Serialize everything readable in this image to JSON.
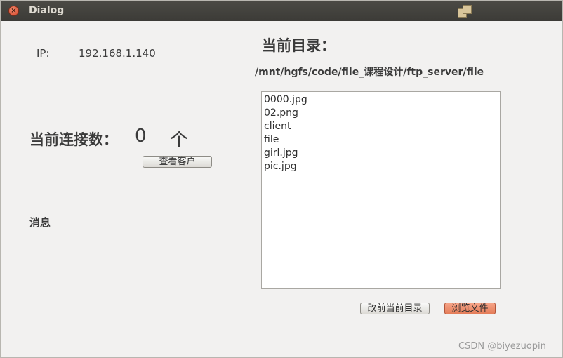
{
  "window": {
    "title": "Dialog"
  },
  "ip": {
    "label": "IP:",
    "value": "192.168.1.140"
  },
  "connections": {
    "label": "当前连接数：",
    "count": "0",
    "unit": "个",
    "view_button": "查看客户"
  },
  "messages": {
    "label": "消息"
  },
  "directory": {
    "title": "当前目录：",
    "path": "/mnt/hgfs/code/file_课程设计/ftp_server/file",
    "files": [
      "0000.jpg",
      "02.png",
      "client",
      "file",
      "girl.jpg",
      "pic.jpg"
    ]
  },
  "buttons": {
    "change_dir": "改前当前目录",
    "browse": "浏览文件"
  },
  "watermark": "CSDN @biyezuopin",
  "colors": {
    "titlebar": "#3c3b37",
    "close": "#d5472b",
    "browse_button": "#e47c58",
    "background": "#f2f1f0"
  }
}
